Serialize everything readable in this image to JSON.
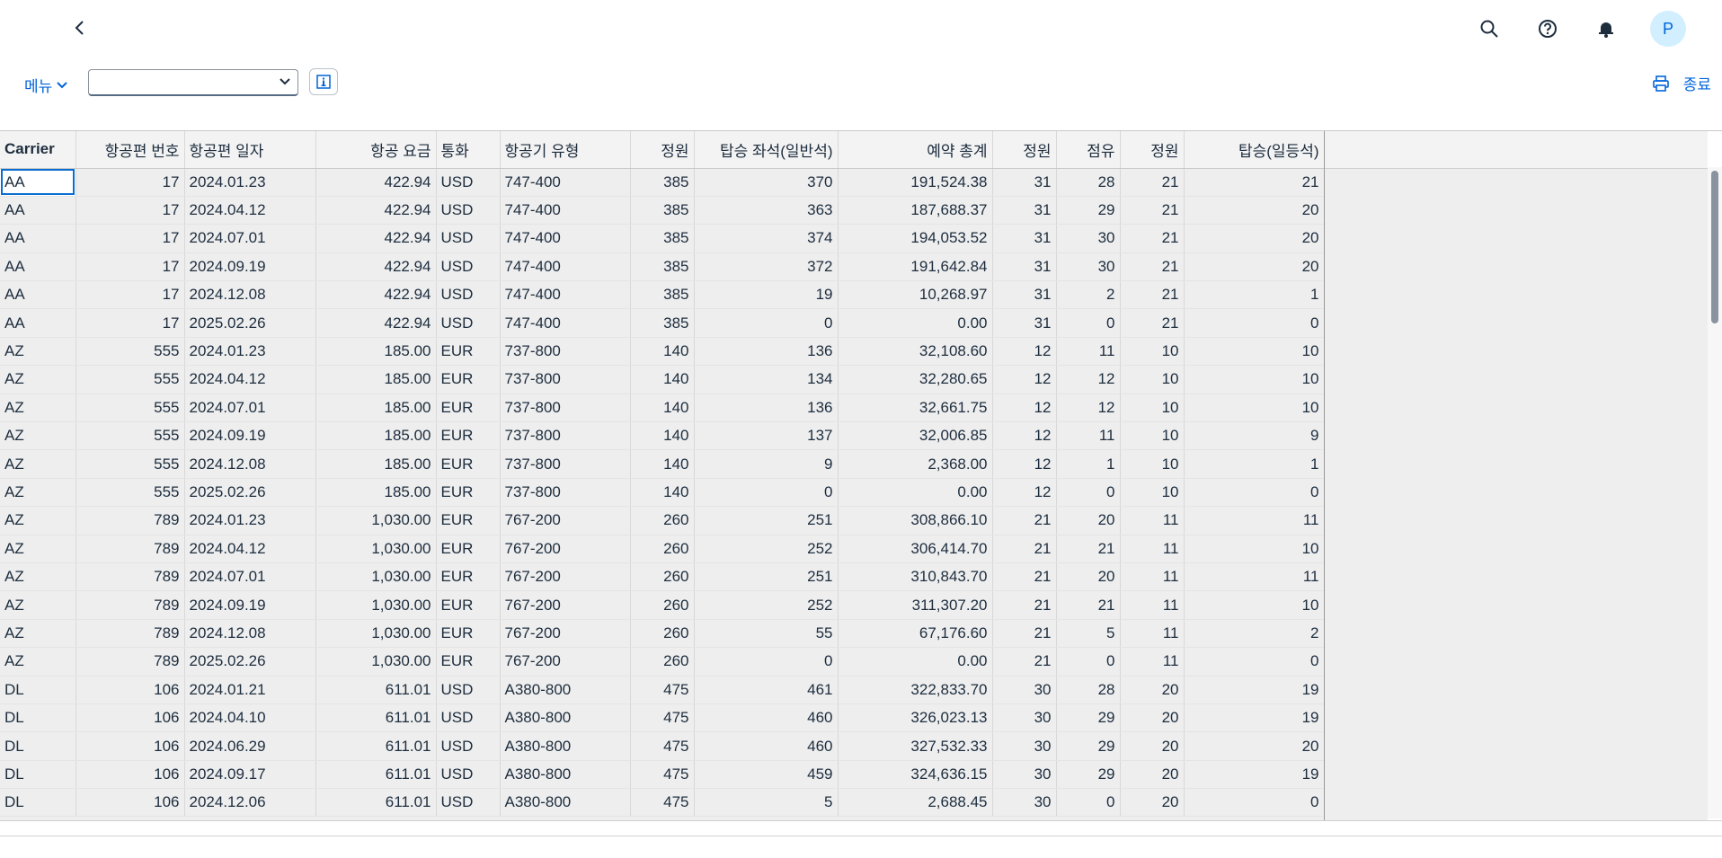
{
  "shell": {
    "icons": [
      "back-icon",
      "search-icon",
      "help-icon",
      "bell-icon"
    ],
    "avatar_initial": "P",
    "accent_color": "#0064d9"
  },
  "toolbar": {
    "menu_label": "메뉴",
    "select_value": "",
    "exit_label": "종료"
  },
  "table": {
    "columns": [
      {
        "label": "Carrier",
        "align": "l"
      },
      {
        "label": "항공편 번호",
        "align": "r"
      },
      {
        "label": "항공편 일자",
        "align": "l"
      },
      {
        "label": "항공 요금",
        "align": "r"
      },
      {
        "label": "통화",
        "align": "l"
      },
      {
        "label": "항공기 유형",
        "align": "l"
      },
      {
        "label": "정원",
        "align": "r"
      },
      {
        "label": "탑승 좌석(일반석)",
        "align": "r"
      },
      {
        "label": "예약 총계",
        "align": "r"
      },
      {
        "label": "정원",
        "align": "r"
      },
      {
        "label": "점유",
        "align": "r"
      },
      {
        "label": "정원",
        "align": "r"
      },
      {
        "label": "탑승(일등석)",
        "align": "r"
      }
    ],
    "rows": [
      [
        "AA",
        "17",
        "2024.01.23",
        "422.94",
        "USD",
        "747-400",
        "385",
        "370",
        "191,524.38",
        "31",
        "28",
        "21",
        "21"
      ],
      [
        "AA",
        "17",
        "2024.04.12",
        "422.94",
        "USD",
        "747-400",
        "385",
        "363",
        "187,688.37",
        "31",
        "29",
        "21",
        "20"
      ],
      [
        "AA",
        "17",
        "2024.07.01",
        "422.94",
        "USD",
        "747-400",
        "385",
        "374",
        "194,053.52",
        "31",
        "30",
        "21",
        "20"
      ],
      [
        "AA",
        "17",
        "2024.09.19",
        "422.94",
        "USD",
        "747-400",
        "385",
        "372",
        "191,642.84",
        "31",
        "30",
        "21",
        "20"
      ],
      [
        "AA",
        "17",
        "2024.12.08",
        "422.94",
        "USD",
        "747-400",
        "385",
        "19",
        "10,268.97",
        "31",
        "2",
        "21",
        "1"
      ],
      [
        "AA",
        "17",
        "2025.02.26",
        "422.94",
        "USD",
        "747-400",
        "385",
        "0",
        "0.00",
        "31",
        "0",
        "21",
        "0"
      ],
      [
        "AZ",
        "555",
        "2024.01.23",
        "185.00",
        "EUR",
        "737-800",
        "140",
        "136",
        "32,108.60",
        "12",
        "11",
        "10",
        "10"
      ],
      [
        "AZ",
        "555",
        "2024.04.12",
        "185.00",
        "EUR",
        "737-800",
        "140",
        "134",
        "32,280.65",
        "12",
        "12",
        "10",
        "10"
      ],
      [
        "AZ",
        "555",
        "2024.07.01",
        "185.00",
        "EUR",
        "737-800",
        "140",
        "136",
        "32,661.75",
        "12",
        "12",
        "10",
        "10"
      ],
      [
        "AZ",
        "555",
        "2024.09.19",
        "185.00",
        "EUR",
        "737-800",
        "140",
        "137",
        "32,006.85",
        "12",
        "11",
        "10",
        "9"
      ],
      [
        "AZ",
        "555",
        "2024.12.08",
        "185.00",
        "EUR",
        "737-800",
        "140",
        "9",
        "2,368.00",
        "12",
        "1",
        "10",
        "1"
      ],
      [
        "AZ",
        "555",
        "2025.02.26",
        "185.00",
        "EUR",
        "737-800",
        "140",
        "0",
        "0.00",
        "12",
        "0",
        "10",
        "0"
      ],
      [
        "AZ",
        "789",
        "2024.01.23",
        "1,030.00",
        "EUR",
        "767-200",
        "260",
        "251",
        "308,866.10",
        "21",
        "20",
        "11",
        "11"
      ],
      [
        "AZ",
        "789",
        "2024.04.12",
        "1,030.00",
        "EUR",
        "767-200",
        "260",
        "252",
        "306,414.70",
        "21",
        "21",
        "11",
        "10"
      ],
      [
        "AZ",
        "789",
        "2024.07.01",
        "1,030.00",
        "EUR",
        "767-200",
        "260",
        "251",
        "310,843.70",
        "21",
        "20",
        "11",
        "11"
      ],
      [
        "AZ",
        "789",
        "2024.09.19",
        "1,030.00",
        "EUR",
        "767-200",
        "260",
        "252",
        "311,307.20",
        "21",
        "21",
        "11",
        "10"
      ],
      [
        "AZ",
        "789",
        "2024.12.08",
        "1,030.00",
        "EUR",
        "767-200",
        "260",
        "55",
        "67,176.60",
        "21",
        "5",
        "11",
        "2"
      ],
      [
        "AZ",
        "789",
        "2025.02.26",
        "1,030.00",
        "EUR",
        "767-200",
        "260",
        "0",
        "0.00",
        "21",
        "0",
        "11",
        "0"
      ],
      [
        "DL",
        "106",
        "2024.01.21",
        "611.01",
        "USD",
        "A380-800",
        "475",
        "461",
        "322,833.70",
        "30",
        "28",
        "20",
        "19"
      ],
      [
        "DL",
        "106",
        "2024.04.10",
        "611.01",
        "USD",
        "A380-800",
        "475",
        "460",
        "326,023.13",
        "30",
        "29",
        "20",
        "19"
      ],
      [
        "DL",
        "106",
        "2024.06.29",
        "611.01",
        "USD",
        "A380-800",
        "475",
        "460",
        "327,532.33",
        "30",
        "29",
        "20",
        "20"
      ],
      [
        "DL",
        "106",
        "2024.09.17",
        "611.01",
        "USD",
        "A380-800",
        "475",
        "459",
        "324,636.15",
        "30",
        "29",
        "20",
        "19"
      ],
      [
        "DL",
        "106",
        "2024.12.06",
        "611.01",
        "USD",
        "A380-800",
        "475",
        "5",
        "2,688.45",
        "30",
        "0",
        "20",
        "0"
      ]
    ]
  }
}
